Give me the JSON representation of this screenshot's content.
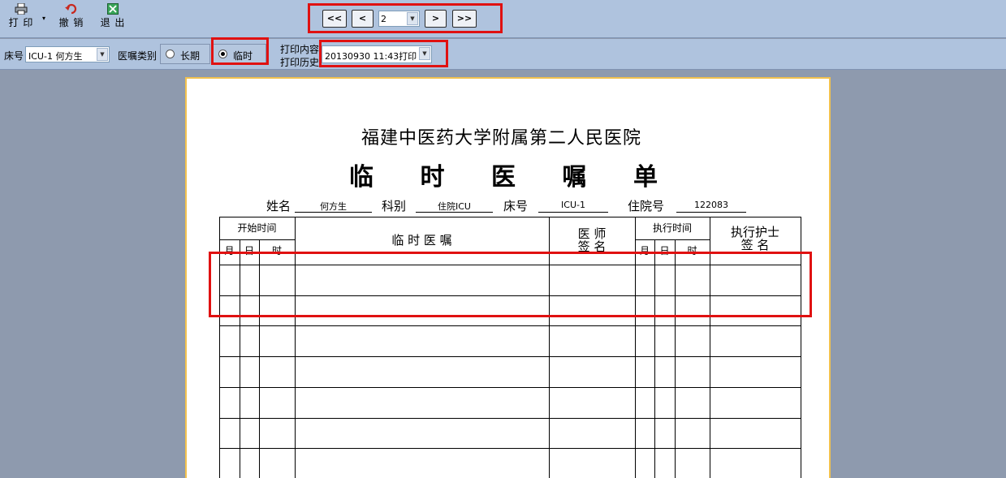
{
  "toolbar": {
    "print_label": "打 印",
    "print_dropdown": "▾",
    "undo_label": "撤 销",
    "exit_label": "退 出"
  },
  "pager": {
    "first_label": "<<",
    "prev_label": "<",
    "page_value": "2",
    "next_label": ">",
    "last_label": ">>"
  },
  "filter": {
    "bed_label": "床号",
    "bed_value": "ICU-1  何方生",
    "order_type_label": "医嘱类别",
    "option_long": "长期",
    "option_temp": "临时",
    "selected_option": "临时",
    "print_content_label": "打印内容",
    "print_history_label": "打印历史",
    "print_history_value": "20130930  11:43打印"
  },
  "form": {
    "hospital_name": "福建中医药大学附属第二人民医院",
    "title_chars": [
      "临",
      "时",
      "医",
      "嘱",
      "单"
    ],
    "name_label": "姓名",
    "name_value": "何方生",
    "dept_label": "科别",
    "dept_value": "住院ICU",
    "bed_label": "床号",
    "bed_value": "ICU-1",
    "admission_label": "住院号",
    "admission_value": "122083",
    "headers": {
      "start_time": "开始时间",
      "month": "月",
      "day": "日",
      "hour": "时",
      "order": "临  时  医  嘱",
      "doctor_line1": "医  师",
      "doctor_line2": "签 名",
      "exec_time": "执行时间",
      "exec_month": "月",
      "exec_day": "日",
      "exec_hour": "时",
      "nurse_line1": "执行护士",
      "nurse_line2": "签      名"
    },
    "row_count": 7
  },
  "colors": {
    "toolbar_bg": "#afc3de",
    "workspace_bg": "#8e9aae",
    "highlight": "#e01111",
    "paper_border": "#f2c14e"
  }
}
